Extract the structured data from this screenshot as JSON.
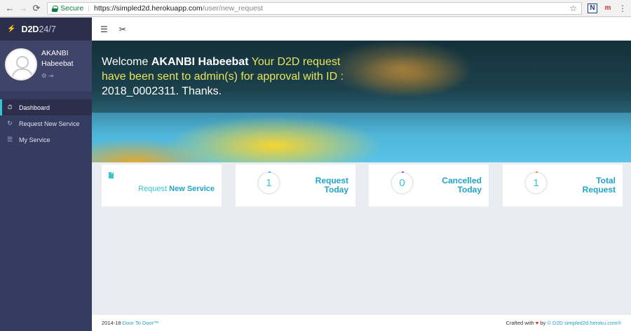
{
  "browser": {
    "secure_label": "Secure",
    "url_host": "https://simpled2d.herokuapp.com",
    "url_path": "/user/new_request",
    "ext_n": "N",
    "ext_m": "m"
  },
  "sidebar": {
    "brand_bold": "D2D",
    "brand_light": "24/7",
    "user_first": "AKANBI",
    "user_last": "Habeebat",
    "items": [
      {
        "label": "Dashboard",
        "icon": "stopwatch-icon"
      },
      {
        "label": "Request New Service",
        "icon": "refresh-icon"
      },
      {
        "label": "My Service",
        "icon": "list-icon"
      }
    ]
  },
  "hero": {
    "welcome": "Welcome",
    "name": "AKANBI Habeebat",
    "message_1": " Your D2D request have been sent to admin(s) for approval with ID : ",
    "request_id": "2018_0002311",
    "message_2": ". Thanks."
  },
  "cards": {
    "request_new": {
      "pre": "Request",
      "bold": "New Service"
    },
    "request_today": {
      "value": "1",
      "line1": "Request",
      "line2": "Today"
    },
    "cancelled_today": {
      "value": "0",
      "line1": "Cancelled",
      "line2": "Today"
    },
    "total_request": {
      "value": "1",
      "line1": "Total",
      "line2": "Request"
    }
  },
  "footer": {
    "year": "2014-18",
    "site_name": "Door To Door™",
    "crafted": "Crafted with",
    "by": "by",
    "credit": "© D2D simpled2d.heroku.com®"
  },
  "colors": {
    "accent": "#36c6d3",
    "sidebar": "#363b60",
    "hero_text": "#e8e55a"
  }
}
